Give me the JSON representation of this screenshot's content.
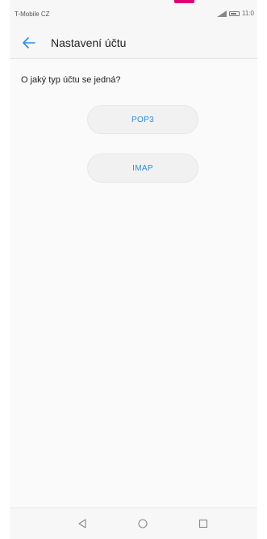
{
  "status_bar": {
    "carrier": "T-Mobile CZ",
    "time": "11:0",
    "icons": [
      "signal-icon",
      "battery-icon"
    ],
    "accent_color": "#e20074"
  },
  "header": {
    "back_icon": "arrow-left-icon",
    "title": "Nastavení účtu"
  },
  "content": {
    "question": "O jaký typ účtu se jedná?",
    "options": [
      {
        "label": "POP3"
      },
      {
        "label": "IMAP"
      }
    ],
    "link_color": "#2a8ee6"
  },
  "nav_bar": {
    "icons": [
      "back-triangle-icon",
      "home-circle-icon",
      "recents-square-icon"
    ]
  }
}
